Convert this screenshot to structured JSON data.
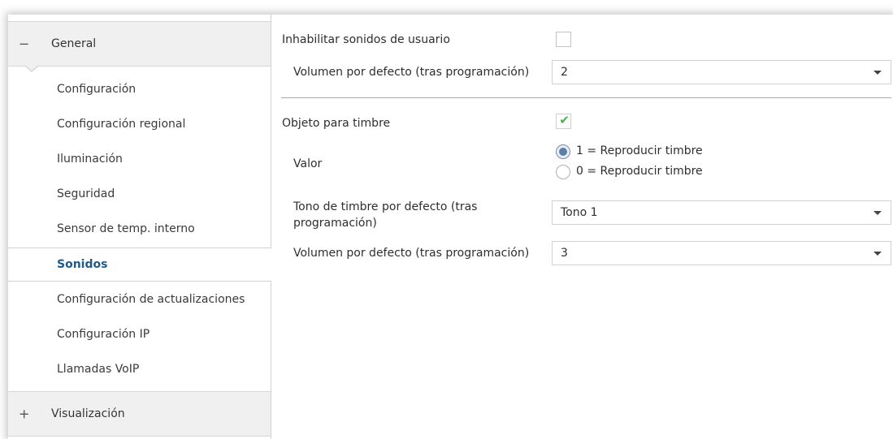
{
  "sidebar": {
    "general": {
      "symbol": "−",
      "label": "General"
    },
    "items": [
      {
        "label": "Configuración"
      },
      {
        "label": "Configuración regional"
      },
      {
        "label": "Iluminación"
      },
      {
        "label": "Seguridad"
      },
      {
        "label": "Sensor de temp. interno"
      },
      {
        "label": "Sonidos",
        "active": true
      },
      {
        "label": "Configuración de actualizaciones"
      },
      {
        "label": "Configuración IP"
      },
      {
        "label": "Llamadas VoIP"
      }
    ],
    "visualizacion": {
      "symbol": "+",
      "label": "Visualización"
    }
  },
  "main": {
    "disable_user_sounds": {
      "label": "Inhabilitar sonidos de usuario",
      "checked": false
    },
    "default_volume_1": {
      "label": "Volumen por defecto (tras programación)",
      "value": "2"
    },
    "bell_object": {
      "label": "Objeto para timbre",
      "checked": true,
      "check_glyph": "✔"
    },
    "valor": {
      "label": "Valor",
      "options": [
        "1 = Reproducir timbre",
        "0 = Reproducir timbre"
      ],
      "selected_index": 0
    },
    "default_tone": {
      "label_line1": "Tono de timbre por defecto (tras",
      "label_line2": "programación)",
      "value": "Tono 1"
    },
    "default_volume_2": {
      "label": "Volumen por defecto (tras programación)",
      "value": "3"
    }
  },
  "colors": {
    "active_nav": "#1e5a8a",
    "check": "#4caf50",
    "radio_selected": "#5b7fa8"
  }
}
